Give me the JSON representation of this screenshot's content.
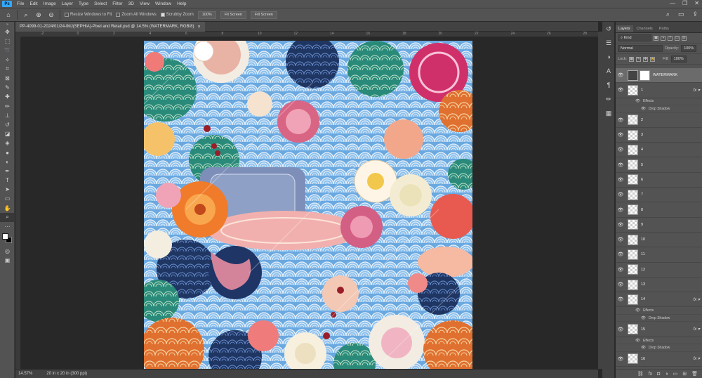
{
  "menubar": {
    "app_icon": "Ps",
    "items": [
      "File",
      "Edit",
      "Image",
      "Layer",
      "Type",
      "Select",
      "Filter",
      "3D",
      "View",
      "Window",
      "Help"
    ],
    "window_controls": [
      "—",
      "❐",
      "✕"
    ]
  },
  "options": {
    "checkboxes": [
      "Resize Windows to Fit",
      "Zoom All Windows",
      "Scrubby Zoom"
    ],
    "buttons": [
      "100%",
      "Fit Screen",
      "Fill Screen"
    ]
  },
  "document": {
    "tab_title": "PP-4099-01-2024/01/24-IMJ(SEPHIA)-Pixel and Retail.psd @ 14.5% (WATERMARK, RGB/8)",
    "tab_close": "×"
  },
  "ruler_marks": [
    "-2",
    "0",
    "2",
    "4",
    "6",
    "8",
    "10",
    "12",
    "14",
    "16",
    "18",
    "20",
    "22",
    "24",
    "26",
    "28"
  ],
  "status": {
    "zoom": "14.57%",
    "doc_info": "20 in x 20 in (300 ppi)"
  },
  "panel": {
    "tabs": [
      "Layers",
      "Channels",
      "Paths"
    ],
    "filter_kind": "Kind",
    "blend_mode": "Normal",
    "opacity_label": "Opacity:",
    "opacity_value": "100%",
    "lock_label": "Lock:",
    "fill_label": "Fill:",
    "fill_value": "100%",
    "layers": [
      {
        "name": "WATERMARK",
        "selected": true,
        "fx": false,
        "thumb": "mask"
      },
      {
        "name": "1",
        "fx": true,
        "effects": [
          "Effects",
          "Drop Shadow"
        ]
      },
      {
        "name": "2"
      },
      {
        "name": "3"
      },
      {
        "name": "4"
      },
      {
        "name": "5"
      },
      {
        "name": "6"
      },
      {
        "name": "7"
      },
      {
        "name": "8"
      },
      {
        "name": "9"
      },
      {
        "name": "10"
      },
      {
        "name": "11"
      },
      {
        "name": "12"
      },
      {
        "name": "13"
      },
      {
        "name": "14",
        "fx": true,
        "effects": [
          "Effects",
          "Drop Shadow"
        ]
      },
      {
        "name": "15",
        "fx": true,
        "effects": [
          "Effects",
          "Drop Shadow"
        ]
      },
      {
        "name": "16",
        "fx": true
      }
    ]
  },
  "colors": {
    "accent": "#31a8ff",
    "panel_bg": "#535353",
    "canvas_bg": "#282828"
  }
}
